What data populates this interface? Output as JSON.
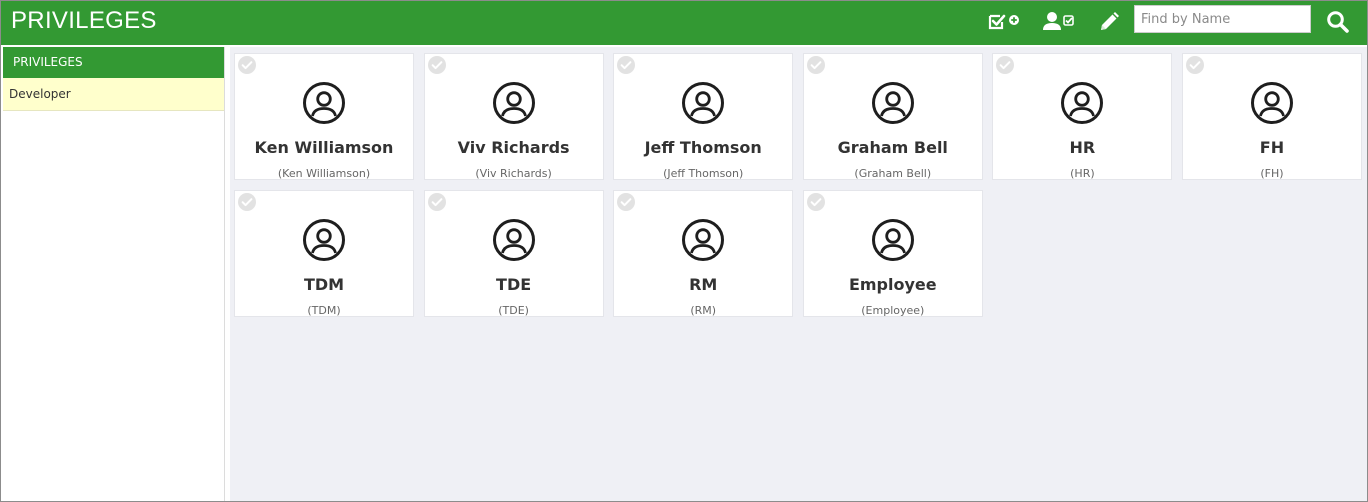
{
  "header": {
    "title": "PRIVILEGES",
    "icons": [
      "add-privilege-icon",
      "assign-user-icon",
      "edit-pencil-icon",
      "search-icon"
    ],
    "search": {
      "placeholder": "Find by Name",
      "value": ""
    }
  },
  "sidebar": {
    "header": "PRIVILEGES",
    "items": [
      {
        "label": "Developer",
        "selected": true
      }
    ]
  },
  "cards": [
    {
      "name": "Ken Williamson",
      "sub": "(Ken Williamson)"
    },
    {
      "name": "Viv Richards",
      "sub": "(Viv Richards)"
    },
    {
      "name": "Jeff Thomson",
      "sub": "(Jeff Thomson)"
    },
    {
      "name": "Graham Bell",
      "sub": "(Graham Bell)"
    },
    {
      "name": "HR",
      "sub": "(HR)"
    },
    {
      "name": "FH",
      "sub": "(FH)"
    },
    {
      "name": "TDM",
      "sub": "(TDM)"
    },
    {
      "name": "TDE",
      "sub": "(TDE)"
    },
    {
      "name": "RM",
      "sub": "(RM)"
    },
    {
      "name": "Employee",
      "sub": "(Employee)"
    }
  ],
  "colors": {
    "accent": "#339933",
    "selected_item": "#ffffcc",
    "content_bg": "#eff0f5"
  }
}
